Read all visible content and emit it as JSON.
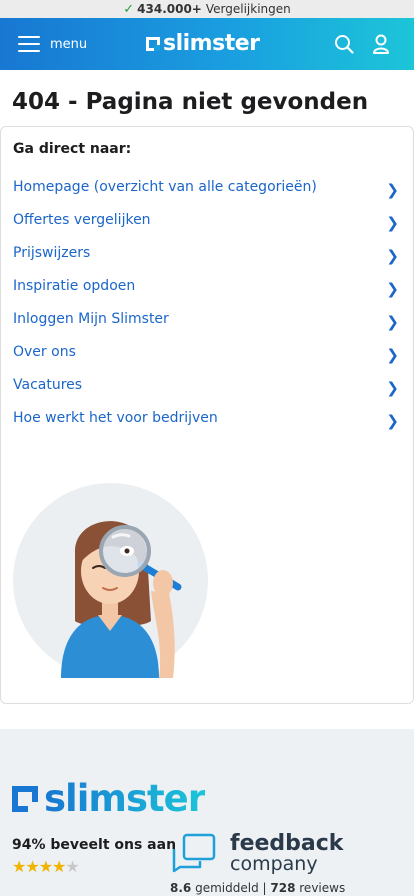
{
  "topbar": {
    "count": "434.000+",
    "text": "Vergelijkingen"
  },
  "header": {
    "menu_label": "menu",
    "logo_text": "slimster"
  },
  "page": {
    "title": "404 - Pagina niet gevonden"
  },
  "card": {
    "label": "Ga direct naar:",
    "links": [
      "Homepage (overzicht van alle categorieën)",
      "Offertes vergelijken",
      "Prijswijzers",
      "Inspiratie opdoen",
      "Inloggen Mijn Slimster",
      "Over ons",
      "Vacatures",
      "Hoe werkt het voor bedrijven"
    ]
  },
  "footer": {
    "logo_text": "slimster",
    "recommend": "94% beveelt ons aan",
    "stars_rating": 4.5,
    "feedback_line1": "feedback",
    "feedback_line2": "company",
    "score": "8.6",
    "score_suffix": "gemiddeld |",
    "reviews_count": "728",
    "reviews_label": "reviews"
  },
  "colors": {
    "link": "#1b66c9",
    "brand_start": "#1877d2",
    "brand_end": "#1cc5d8"
  }
}
